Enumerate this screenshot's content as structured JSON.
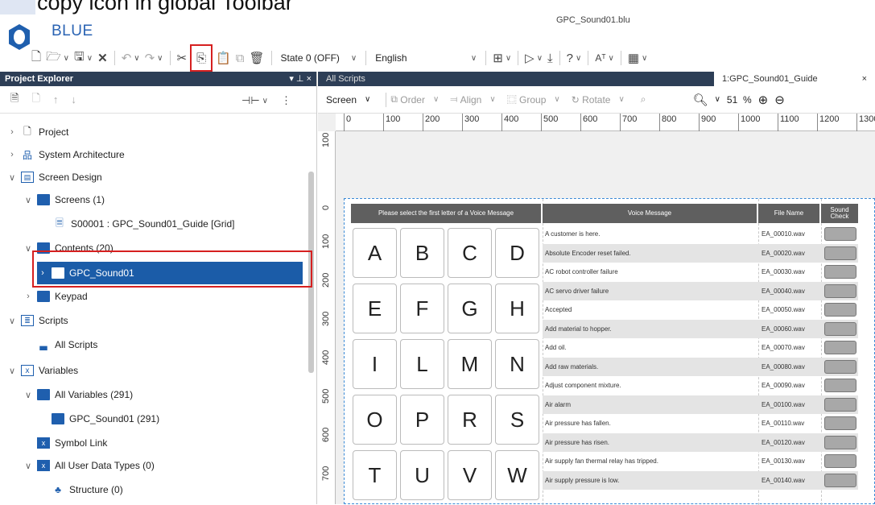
{
  "caption": "copy icon in global Toolbar",
  "window": {
    "title": "GPC_Sound01.blu",
    "brand": "BLUE"
  },
  "toolbar": {
    "state_select": "State 0 (OFF)",
    "language_select": "English",
    "icons": [
      "new-file-icon",
      "open-icon",
      "save-icon",
      "close-icon",
      "undo-icon",
      "redo-icon",
      "cut-icon",
      "copy-icon",
      "paste-icon",
      "duplicate-icon",
      "delete-icon",
      "layout-icon",
      "run-icon",
      "download-icon",
      "help-icon",
      "font-icon",
      "grid-icon"
    ]
  },
  "explorer": {
    "title": "Project Explorer",
    "pin": "▾ ⊥ ×",
    "tree": [
      {
        "label": "Project",
        "icon": "page-icon",
        "expanded": false
      },
      {
        "label": "System Architecture",
        "icon": "network-icon",
        "expanded": false
      },
      {
        "label": "Screen Design",
        "icon": "screen-design-icon",
        "expanded": true
      },
      {
        "label": "Screens (1)",
        "icon": "folder-icon",
        "expanded": true
      },
      {
        "label": "S00001 : GPC_Sound01_Guide [Grid]",
        "icon": "screen-icon"
      },
      {
        "label": "Contents (20)",
        "icon": "folder-icon",
        "expanded": true
      },
      {
        "label": "GPC_Sound01",
        "icon": "folder-icon",
        "selected": true
      },
      {
        "label": "Keypad",
        "icon": "folder-icon",
        "expanded": false
      },
      {
        "label": "Scripts",
        "icon": "scripts-icon",
        "expanded": true
      },
      {
        "label": "All Scripts",
        "icon": "all-scripts-icon"
      },
      {
        "label": "Variables",
        "icon": "variables-icon",
        "expanded": true
      },
      {
        "label": "All Variables (291)",
        "icon": "folder-icon",
        "expanded": true
      },
      {
        "label": "GPC_Sound01 (291)",
        "icon": "folder-icon"
      },
      {
        "label": "Symbol Link",
        "icon": "symbol-link-icon"
      },
      {
        "label": "All User Data Types (0)",
        "icon": "user-data-type-icon",
        "expanded": true
      },
      {
        "label": "Structure (0)",
        "icon": "structure-icon"
      }
    ]
  },
  "editor": {
    "tab_all": "All Scripts",
    "tab_active": "1:GPC_Sound01_Guide",
    "tools": {
      "screen": "Screen",
      "order": "Order",
      "align": "Align",
      "group": "Group",
      "rotate": "Rotate",
      "zoom": "51",
      "zoom_unit": "%"
    },
    "hruler": [
      "0",
      "100",
      "200",
      "300",
      "400",
      "500",
      "600",
      "700",
      "800",
      "900",
      "1000",
      "1100",
      "1200",
      "1300"
    ],
    "vruler": [
      "100",
      "0",
      "100",
      "200",
      "300",
      "400",
      "500",
      "600",
      "700"
    ]
  },
  "screen": {
    "headers": {
      "letter": "Please select the first letter of a Voice Message",
      "voice": "Voice Message",
      "file": "File Name",
      "sound": "Sound Check"
    },
    "letters": [
      "A",
      "B",
      "C",
      "D",
      "E",
      "F",
      "G",
      "H",
      "I",
      "L",
      "M",
      "N",
      "O",
      "P",
      "R",
      "S",
      "T",
      "U",
      "V",
      "W"
    ],
    "rows": [
      {
        "message": "A customer is here.",
        "file": "EA_00010.wav"
      },
      {
        "message": "Absolute Encoder reset failed.",
        "file": "EA_00020.wav"
      },
      {
        "message": "AC robot controller failure",
        "file": "EA_00030.wav"
      },
      {
        "message": "AC servo driver failure",
        "file": "EA_00040.wav"
      },
      {
        "message": "Accepted",
        "file": "EA_00050.wav"
      },
      {
        "message": "Add material to hopper.",
        "file": "EA_00060.wav"
      },
      {
        "message": "Add oil.",
        "file": "EA_00070.wav"
      },
      {
        "message": "Add raw materials.",
        "file": "EA_00080.wav"
      },
      {
        "message": "Adjust component mixture.",
        "file": "EA_00090.wav"
      },
      {
        "message": "Air alarm",
        "file": "EA_00100.wav"
      },
      {
        "message": "Air pressure has fallen.",
        "file": "EA_00110.wav"
      },
      {
        "message": "Air pressure has risen.",
        "file": "EA_00120.wav"
      },
      {
        "message": "Air supply fan thermal relay has tripped.",
        "file": "EA_00130.wav"
      },
      {
        "message": "Air supply pressure is low.",
        "file": "EA_00140.wav"
      }
    ]
  },
  "colors": {
    "accent": "#1b5ca8",
    "highlight": "#d62020",
    "header_bg": "#2d3e56"
  }
}
